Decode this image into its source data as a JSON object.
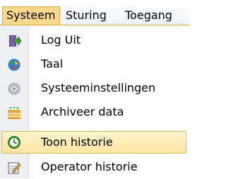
{
  "menubar": {
    "items": [
      {
        "label": "Systeem"
      },
      {
        "label": "Sturing"
      },
      {
        "label": "Toegang"
      }
    ]
  },
  "dropdown": {
    "items": [
      {
        "label": "Log Uit",
        "icon": "logout-icon"
      },
      {
        "label": "Taal",
        "icon": "globe-icon"
      },
      {
        "label": "Systeeminstellingen",
        "icon": "settings-icon"
      },
      {
        "label": "Archiveer data",
        "icon": "archive-icon"
      },
      {
        "label": "Toon historie",
        "icon": "history-icon"
      },
      {
        "label": "Operator historie",
        "icon": "edit-icon"
      }
    ]
  },
  "colors": {
    "highlight": "#ffe49e",
    "highlight_border": "#e3b35b"
  }
}
